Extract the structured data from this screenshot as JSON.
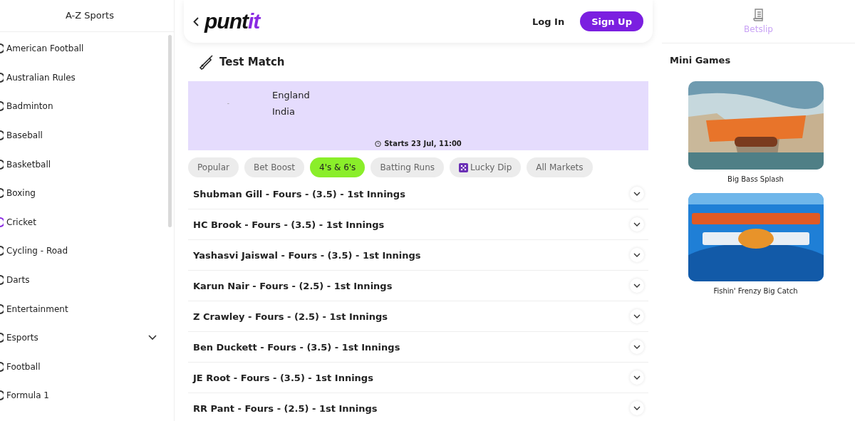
{
  "sidebar": {
    "title": "A-Z Sports",
    "items": [
      {
        "label": "American Football",
        "selected": false
      },
      {
        "label": "Australian Rules",
        "selected": false
      },
      {
        "label": "Badminton",
        "selected": false
      },
      {
        "label": "Baseball",
        "selected": false
      },
      {
        "label": "Basketball",
        "selected": false
      },
      {
        "label": "Boxing",
        "selected": false
      },
      {
        "label": "Cricket",
        "selected": true
      },
      {
        "label": "Cycling - Road",
        "selected": false
      },
      {
        "label": "Darts",
        "selected": false
      },
      {
        "label": "Entertainment",
        "selected": false
      },
      {
        "label": "Esports",
        "selected": false,
        "expanded": false
      },
      {
        "label": "Football",
        "selected": false
      },
      {
        "label": "Formula 1",
        "selected": false
      }
    ]
  },
  "header": {
    "logo": {
      "text": "punt",
      "accent": "it"
    },
    "login": "Log In",
    "signup": "Sign Up"
  },
  "event": {
    "title": "Test Match",
    "separator": "-",
    "teams": [
      "England",
      "India"
    ],
    "start": "Starts 23 Jul, 11:00"
  },
  "tabs": [
    {
      "label": "Popular",
      "selected": false
    },
    {
      "label": "Bet Boost",
      "selected": false
    },
    {
      "label": "4's & 6's",
      "selected": true
    },
    {
      "label": "Batting Runs",
      "selected": false
    },
    {
      "label": "Lucky Dip",
      "selected": false,
      "kind": "icon"
    },
    {
      "label": "All Markets",
      "selected": false
    }
  ],
  "markets": [
    {
      "label": "Shubman Gill - Fours - (3.5) - 1st Innings",
      "expanded": false
    },
    {
      "label": "HC Brook - Fours - (3.5) - 1st Innings",
      "expanded": false
    },
    {
      "label": "Yashasvi Jaiswal - Fours - (3.5) - 1st Innings",
      "expanded": false
    },
    {
      "label": "Karun Nair - Fours - (2.5) - 1st Innings",
      "expanded": false
    },
    {
      "label": "Z Crawley - Fours - (2.5) - 1st Innings",
      "expanded": false
    },
    {
      "label": "Ben Duckett - Fours - (3.5) - 1st Innings",
      "expanded": false
    },
    {
      "label": "JE Root - Fours - (3.5) - 1st Innings",
      "expanded": false
    },
    {
      "label": "RR Pant - Fours - (2.5) - 1st Innings",
      "expanded": false
    }
  ],
  "betslip": {
    "label": "Betslip"
  },
  "mini_games": {
    "title": "Mini Games",
    "games": [
      {
        "name": "Big Bass Splash",
        "kind": "picture"
      },
      {
        "name": "Fishin' Frenzy Big Catch",
        "kind": "picture"
      }
    ]
  }
}
